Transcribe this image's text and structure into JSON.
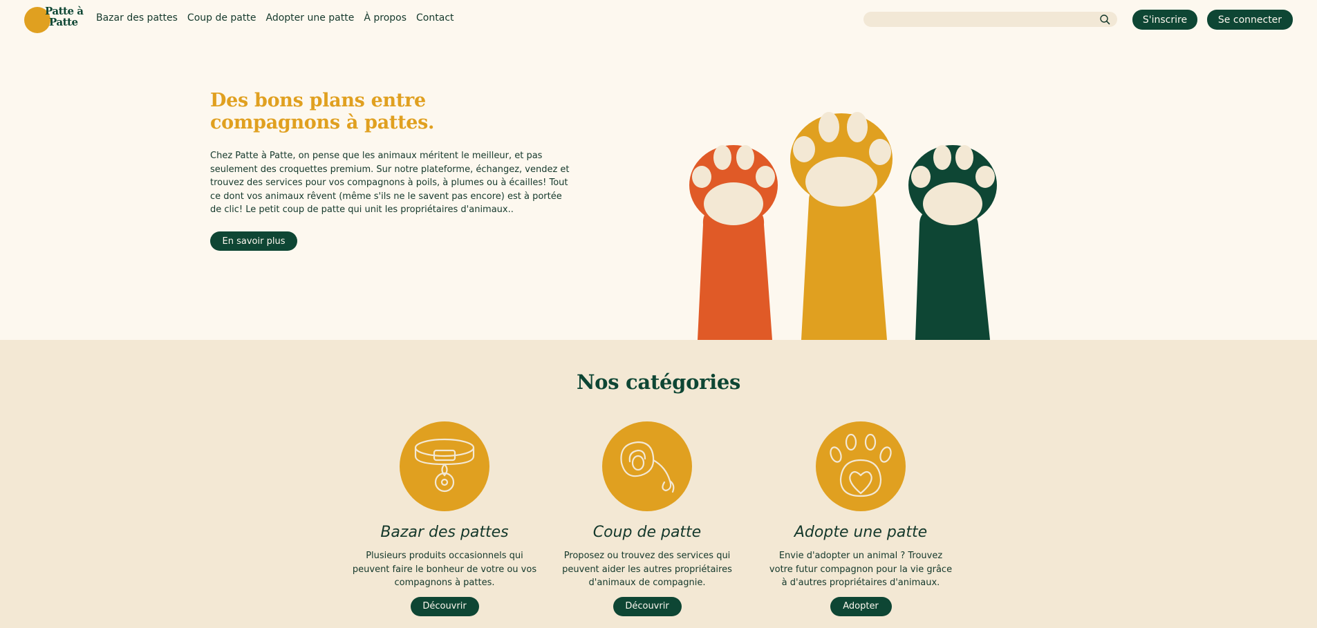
{
  "header": {
    "logo": {
      "line1": "Patte à",
      "line2": "Patte"
    },
    "nav": [
      "Bazar des pattes",
      "Coup de patte",
      "Adopter une patte",
      "À propos",
      "Contact"
    ],
    "search": {
      "placeholder": "",
      "icon": "search-icon"
    },
    "signup_label": "S'inscrire",
    "login_label": "Se connecter"
  },
  "hero": {
    "title": "Des bons plans entre compagnons à pattes.",
    "text": "Chez Patte à Patte, on pense que les animaux méritent le meilleur, et pas seulement des croquettes premium. Sur notre plateforme, échangez, vendez et trouvez des services pour vos compagnons à poils, à plumes ou à écailles! Tout ce dont vos animaux rêvent (même s'ils ne le savent pas encore) est à portée de clic! Le petit coup de patte qui unit les propriétaires d'animaux..",
    "button_label": "En savoir plus",
    "paw_colors": [
      "#e05a27",
      "#e0a020",
      "#0e4634"
    ]
  },
  "categories": {
    "title": "Nos catégories",
    "items": [
      {
        "icon": "collar-icon",
        "title": "Bazar des pattes",
        "description": "Plusieurs produits occasionnels qui peuvent faire le bonheur de votre ou vos compagnons à pattes.",
        "button_label": "Découvrir"
      },
      {
        "icon": "leash-icon",
        "title": "Coup de patte",
        "description": "Proposez ou trouvez des services qui peuvent aider les autres propriétaires d'animaux de compagnie.",
        "button_label": "Découvrir"
      },
      {
        "icon": "paw-heart-icon",
        "title": "Adopte une patte",
        "description": "Envie d'adopter un animal ? Trouvez votre futur compagnon pour la vie grâce à d'autres propriétaires d'animaux.",
        "button_label": "Adopter"
      }
    ]
  },
  "colors": {
    "background": "#fdf8ef",
    "section_bg": "#f3e8d4",
    "accent_yellow": "#e0a020",
    "accent_orange": "#e05a27",
    "dark_green": "#0e4634"
  }
}
